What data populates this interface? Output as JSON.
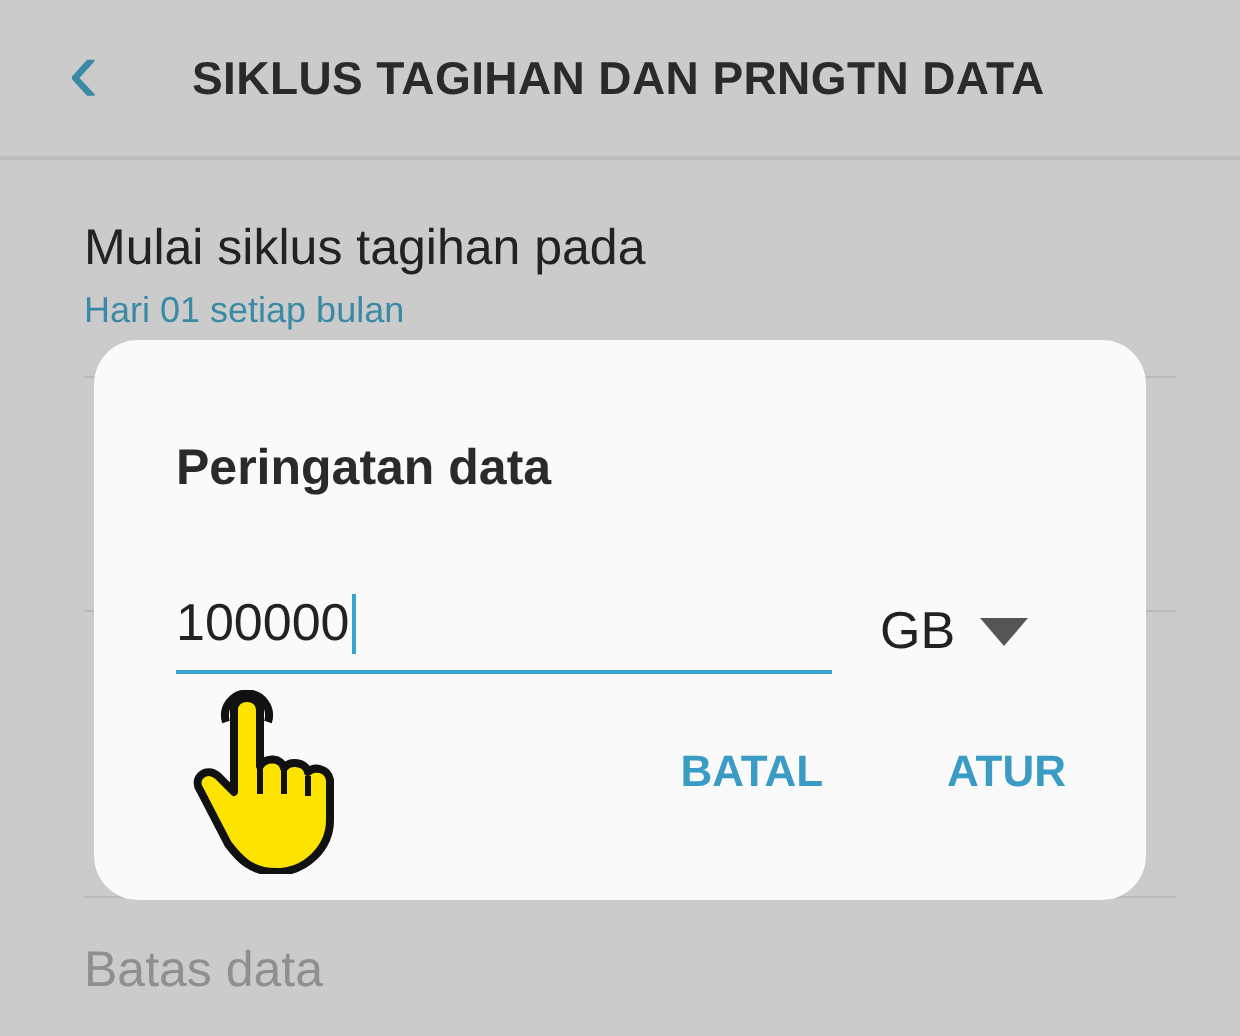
{
  "header": {
    "back": "‹",
    "title": "SIKLUS TAGIHAN DAN PRNGTN DATA"
  },
  "settings": [
    {
      "title": "Mulai siklus tagihan pada",
      "subtitle": "Hari 01 setiap bulan",
      "disabled": false,
      "hidden": false
    },
    {
      "hidden": true
    },
    {
      "hidden": true
    },
    {
      "title": "Batas data",
      "disabled": true,
      "hidden": false
    }
  ],
  "dialog": {
    "title": "Peringatan data",
    "value": "100000",
    "unit": "GB",
    "buttons": [
      "BATAL",
      "ATUR"
    ]
  }
}
